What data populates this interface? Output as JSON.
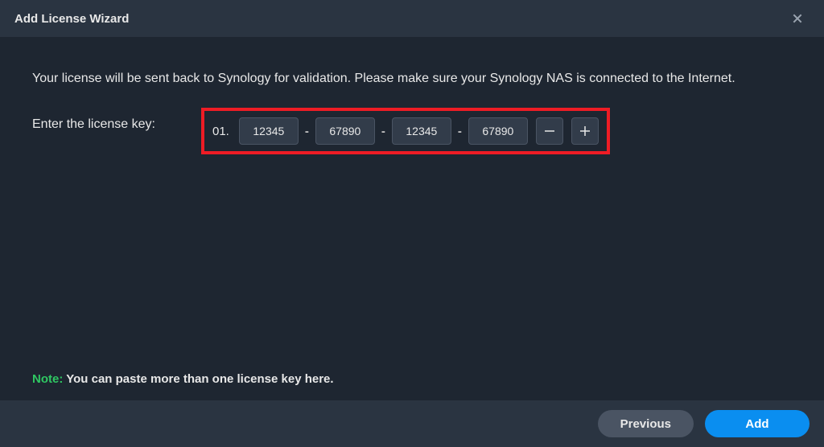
{
  "titlebar": {
    "title": "Add License Wizard"
  },
  "content": {
    "description": "Your license will be sent back to Synology for validation. Please make sure your Synology NAS is connected to the Internet.",
    "enter_label": "Enter the license key:",
    "row_number": "01.",
    "segments": {
      "s1": "12345",
      "s2": "67890",
      "s3": "12345",
      "s4": "67890"
    },
    "dash": "-"
  },
  "note": {
    "label": "Note:",
    "text": " You can paste more than one license key here."
  },
  "footer": {
    "previous": "Previous",
    "add": "Add"
  }
}
